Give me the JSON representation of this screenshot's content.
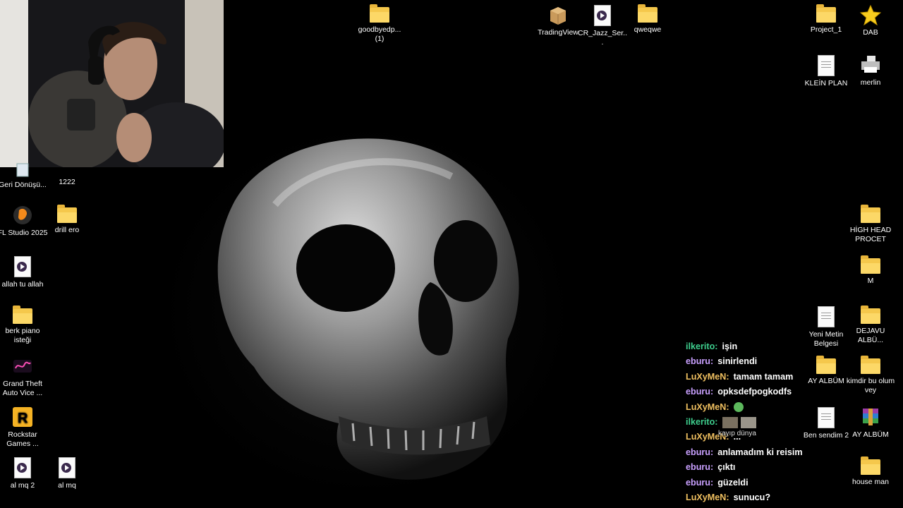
{
  "webcam": {
    "description_icon": "webcam-feed"
  },
  "desktop": {
    "icons_top": [
      {
        "label": "goodbyedp... (1)",
        "type": "folder"
      },
      {
        "label": "TradingView",
        "type": "package"
      },
      {
        "label": "CR_Jazz_Ser...",
        "type": "media"
      },
      {
        "label": "qweqwe",
        "type": "folder"
      },
      {
        "label": "Project_1",
        "type": "folder-badge"
      },
      {
        "label": "DAB",
        "type": "star"
      }
    ],
    "icons_right": [
      {
        "label": "KLEİN PLAN",
        "type": "doc"
      },
      {
        "label": "merlin",
        "type": "printer"
      },
      {
        "label": "HİGH HEAD PROCET",
        "type": "folder"
      },
      {
        "label": "M",
        "type": "folder"
      },
      {
        "label": "Yeni Metin Belgesi",
        "type": "doc"
      },
      {
        "label": "DEJAVU ALBÜ...",
        "type": "folder"
      },
      {
        "label": "AY ALBÜM",
        "type": "folder"
      },
      {
        "label": "kimdir bu olum vey",
        "type": "folder"
      },
      {
        "label": "Ben sendim 2",
        "type": "doc"
      },
      {
        "label": "AY ALBÜM",
        "type": "archive"
      },
      {
        "label": "house man",
        "type": "folder"
      }
    ],
    "icons_left": [
      {
        "label": "Geri Dönüşü...",
        "type": "recycle"
      },
      {
        "label": "1222",
        "type": "folder"
      },
      {
        "label": "FL Studio 2025",
        "type": "app"
      },
      {
        "label": "drill ero",
        "type": "folder"
      },
      {
        "label": "allah tu allah",
        "type": "media"
      },
      {
        "label": "berk piano isteği",
        "type": "folder"
      },
      {
        "label": "Grand Theft Auto Vice ...",
        "type": "app"
      },
      {
        "label": "Rockstar Games ...",
        "type": "app"
      },
      {
        "label": "al mq 2",
        "type": "media"
      },
      {
        "label": "al mq",
        "type": "media"
      }
    ]
  },
  "chat": {
    "messages": [
      {
        "user": "ilkerito:",
        "text": "işin",
        "color": "#3ecf8e"
      },
      {
        "user": "eburu:",
        "text": "sinirlendi",
        "color": "#c9a0ff"
      },
      {
        "user": "LuXyMeN:",
        "text": "tamam tamam",
        "color": "#f0c060"
      },
      {
        "user": "eburu:",
        "text": "opksdefpogkodfs",
        "color": "#c9a0ff"
      },
      {
        "user": "LuXyMeN:",
        "text": "",
        "color": "#f0c060"
      },
      {
        "user": "ilkerito:",
        "text": "",
        "color": "#3ecf8e"
      },
      {
        "user": "LuXyMeN:",
        "text": "...",
        "color": "#f0c060"
      },
      {
        "user": "eburu:",
        "text": "anlamadım ki reisim",
        "color": "#c9a0ff"
      },
      {
        "user": "eburu:",
        "text": "çıktı",
        "color": "#c9a0ff"
      },
      {
        "user": "eburu:",
        "text": "güzeldi",
        "color": "#c9a0ff"
      },
      {
        "user": "LuXyMeN:",
        "text": "sunucu?",
        "color": "#f0c060"
      }
    ],
    "emote_caption": "kayıp dünya"
  }
}
